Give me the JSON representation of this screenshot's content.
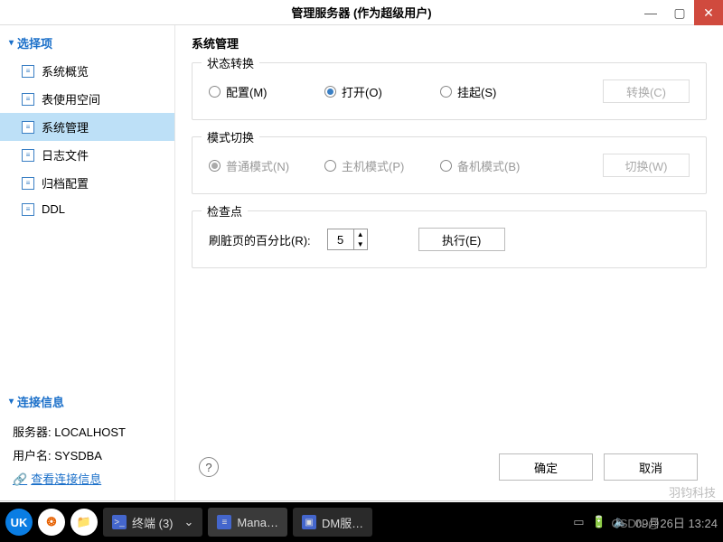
{
  "title": "管理服务器  (作为超级用户)",
  "sidebar": {
    "section1": "选择项",
    "items": [
      "系统概览",
      "表使用空间",
      "系统管理",
      "日志文件",
      "归档配置",
      "DDL"
    ],
    "selected": 2,
    "section2": "连接信息",
    "server_label": "服务器: LOCALHOST",
    "user_label": "用户名: SYSDBA",
    "view_link": "查看连接信息"
  },
  "main": {
    "heading": "系统管理",
    "group1": {
      "label": "状态转换",
      "radios": [
        {
          "label": "配置(M)",
          "checked": false
        },
        {
          "label": "打开(O)",
          "checked": true
        },
        {
          "label": "挂起(S)",
          "checked": false
        }
      ],
      "button": "转换(C)"
    },
    "group2": {
      "label": "模式切换",
      "radios": [
        {
          "label": "普通模式(N)",
          "checked": true
        },
        {
          "label": "主机模式(P)",
          "checked": false
        },
        {
          "label": "备机模式(B)",
          "checked": false
        }
      ],
      "button": "切换(W)"
    },
    "group3": {
      "label": "检查点",
      "pct_label": "刷脏页的百分比(R):",
      "pct_value": "5",
      "button": "执行(E)"
    }
  },
  "footer": {
    "ok": "确定",
    "cancel": "取消"
  },
  "taskbar": {
    "tasks": [
      {
        "label": "终端 (3)",
        "icon": ">_"
      },
      {
        "label": "Mana…",
        "icon": "≡"
      },
      {
        "label": "DM服…",
        "icon": "▣"
      }
    ],
    "time": "09月26日 13:24"
  },
  "watermark": "羽钧科技",
  "watermark2": "CSDN @"
}
